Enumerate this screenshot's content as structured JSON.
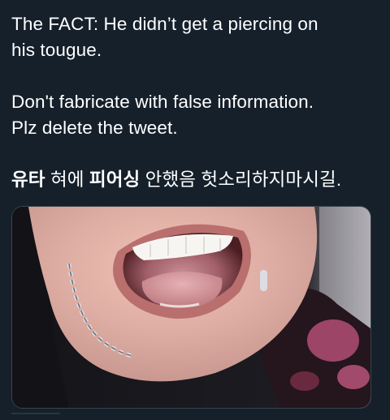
{
  "tweet": {
    "line1": "The FACT: He didn’t get a piercing on",
    "line2": "his tougue.",
    "line3": "Don't fabricate with false information.",
    "line4": "Plz delete the tweet.",
    "korean": {
      "w1": "유타",
      "w2": " 혀에 ",
      "w3": "피어싱",
      "w4": " 안했음 헛소리하지마시길."
    }
  },
  "media": {
    "icon": "photo-open-mouth"
  },
  "colors": {
    "background": "#15202b",
    "text": "#ffffff",
    "border": "#38444d"
  }
}
